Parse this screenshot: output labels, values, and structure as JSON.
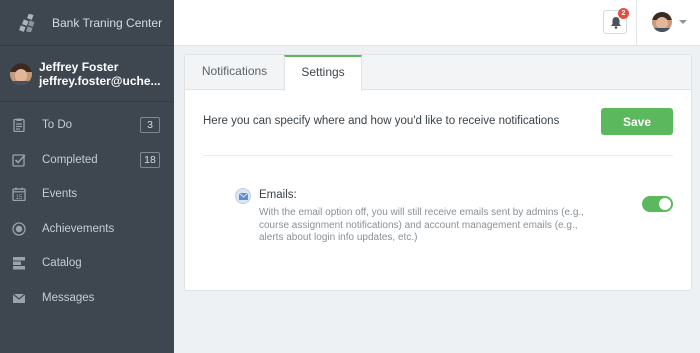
{
  "app": {
    "brand_name": "Bank Traning Center"
  },
  "user": {
    "name": "Jeffrey Foster",
    "email": "jeffrey.foster@uche..."
  },
  "sidebar": {
    "items": [
      {
        "label": "To Do",
        "icon": "clipboard-icon",
        "count": "3"
      },
      {
        "label": "Completed",
        "icon": "checkbox-icon",
        "count": "18"
      },
      {
        "label": "Events",
        "icon": "calendar-icon",
        "calendar_day": "15"
      },
      {
        "label": "Achievements",
        "icon": "badge-icon"
      },
      {
        "label": "Catalog",
        "icon": "catalog-icon"
      },
      {
        "label": "Messages",
        "icon": "envelope-icon"
      }
    ]
  },
  "topbar": {
    "notification_count": "2",
    "icons": [
      "bell-icon",
      "avatar",
      "chevron-down-icon"
    ]
  },
  "tabs": [
    {
      "label": "Notifications",
      "active": false
    },
    {
      "label": "Settings",
      "active": true
    }
  ],
  "settings": {
    "intro": "Here you can specify where and how you'd like to receive notifications",
    "save_label": "Save",
    "email_title": "Emails:",
    "email_desc": "With the email option off, you will still receive emails sent by admins (e.g., course assignment notifications) and account management emails (e.g., alerts about login info updates, etc.)",
    "email_enabled": true
  },
  "colors": {
    "sidebar": "#3e464f",
    "accent": "#5cb85c",
    "badge": "#e74c3c"
  }
}
